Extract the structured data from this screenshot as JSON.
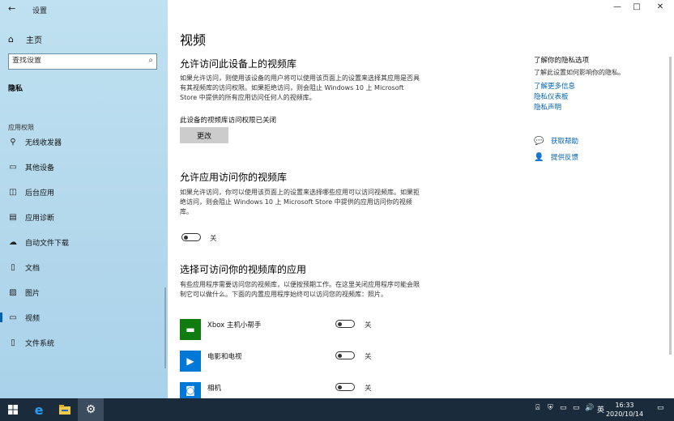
{
  "window": {
    "title": "设置",
    "minimize": "—",
    "maximize": "□",
    "close": "✕"
  },
  "sidebar": {
    "home_label": "主页",
    "search_placeholder": "查找设置",
    "section_title": "隐私",
    "group_label": "应用权限",
    "items": [
      {
        "label": "无线收发器",
        "icon": "radio-icon"
      },
      {
        "label": "其他设备",
        "icon": "devices-icon"
      },
      {
        "label": "后台应用",
        "icon": "background-apps-icon"
      },
      {
        "label": "应用诊断",
        "icon": "diagnostics-icon"
      },
      {
        "label": "自动文件下载",
        "icon": "cloud-icon"
      },
      {
        "label": "文档",
        "icon": "document-icon"
      },
      {
        "label": "图片",
        "icon": "picture-icon"
      },
      {
        "label": "视频",
        "icon": "video-icon"
      },
      {
        "label": "文件系统",
        "icon": "file-system-icon"
      }
    ]
  },
  "main": {
    "title": "视频",
    "section1": {
      "heading": "允许访问此设备上的视频库",
      "description": "如果允许访问，则使用该设备的用户将可以使用该页面上的设置来选择其应用是否具有其视频库的访问权限。如果拒绝访问，则会阻止 Windows 10 上 Microsoft Store 中提供的所有应用访问任何人的视频库。",
      "status": "此设备的视频库访问权限已关闭",
      "button": "更改"
    },
    "section2": {
      "heading": "允许应用访问你的视频库",
      "description": "如果允许访问，你可以使用该页面上的设置来选择哪些应用可以访问视频库。如果拒绝访问，则会阻止 Windows 10 上 Microsoft Store 中提供的应用访问你的视频库。",
      "toggle_label": "关",
      "toggle_on": false
    },
    "section3": {
      "heading": "选择可访问你的视频库的应用",
      "description": "有些应用程序需要访问您的视频库，以便按预期工作。在这里关闭应用程序可能会限制它可以做什么。下面的内置应用程序始终可以访问您的视频库：照片。",
      "apps": [
        {
          "name": "Xbox 主机小帮手",
          "toggle_label": "关",
          "color": "#107c10",
          "icon": "xbox-icon",
          "glyph": "▬"
        },
        {
          "name": "电影和电视",
          "toggle_label": "关",
          "color": "#0078d7",
          "icon": "movies-tv-icon",
          "glyph": "▶"
        },
        {
          "name": "相机",
          "toggle_label": "关",
          "color": "#0078d7",
          "icon": "camera-icon",
          "glyph": "◙"
        }
      ]
    }
  },
  "right": {
    "title": "了解你的隐私选项",
    "subtitle": "了解此设置如何影响你的隐私。",
    "links": [
      "了解更多信息",
      "隐私仪表板",
      "隐私声明"
    ],
    "help": "获取帮助",
    "feedback": "提供反馈"
  },
  "taskbar": {
    "time": "16:33",
    "date": "2020/10/14",
    "ime": "英",
    "volume": "🔊"
  }
}
